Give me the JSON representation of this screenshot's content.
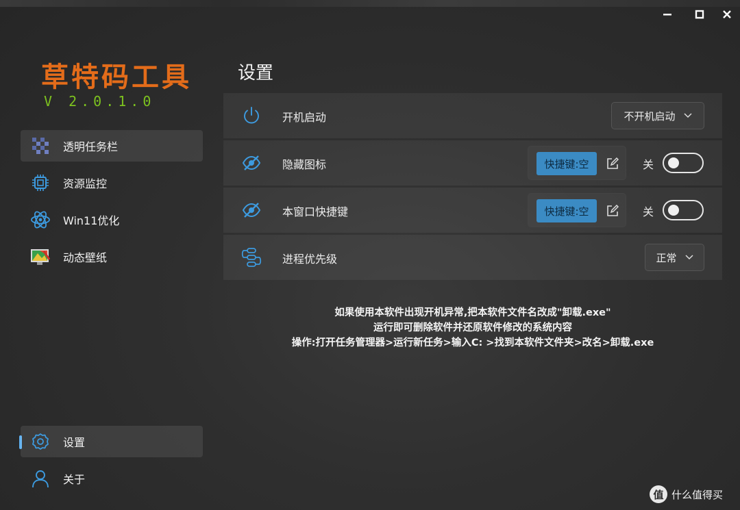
{
  "window": {
    "minimize_glyph": "—",
    "maximize_glyph": "□",
    "close_glyph": "✕"
  },
  "app": {
    "title": "草特码工具",
    "version": "V 2.0.1.0",
    "title_color": "#e36c1a",
    "version_color": "#7dc21f"
  },
  "sidebar": {
    "items": [
      {
        "label": "透明任务栏",
        "icon": "checker-icon",
        "active": true
      },
      {
        "label": "资源监控",
        "icon": "chip-icon",
        "active": false
      },
      {
        "label": "Win11优化",
        "icon": "atom-icon",
        "active": false
      },
      {
        "label": "动态壁纸",
        "icon": "wallpaper-icon",
        "active": false
      }
    ],
    "bottom_items": [
      {
        "label": "设置",
        "icon": "gear-icon",
        "active": true
      },
      {
        "label": "关于",
        "icon": "user-icon",
        "active": false
      }
    ]
  },
  "page": {
    "title": "设置"
  },
  "settings": {
    "startup": {
      "label": "开机启动",
      "icon": "power-icon",
      "value": "不开机启动"
    },
    "hide_icon": {
      "label": "隐藏图标",
      "icon": "eye-off-icon",
      "hotkey": "快捷键:空",
      "toggle_label": "关",
      "on": false
    },
    "window_hotkey": {
      "label": "本窗口快捷键",
      "icon": "eye-off-icon",
      "hotkey": "快捷键:空",
      "toggle_label": "关",
      "on": false
    },
    "priority": {
      "label": "进程优先级",
      "icon": "process-icon",
      "value": "正常"
    }
  },
  "notice": {
    "line1": "如果使用本软件出现开机异常,把本软件文件名改成\"卸载.exe\"",
    "line2": "运行即可删除软件并还原软件修改的系统内容",
    "line3": "操作:打开任务管理器>运行新任务>输入C: >找到本软件文件夹>改名>卸载.exe"
  },
  "watermark": {
    "glyph": "值",
    "text": "什么值得买"
  },
  "colors": {
    "accent": "#3b8bc4",
    "icon_blue": "#3d9be0",
    "indicator": "#5fb0f0"
  }
}
